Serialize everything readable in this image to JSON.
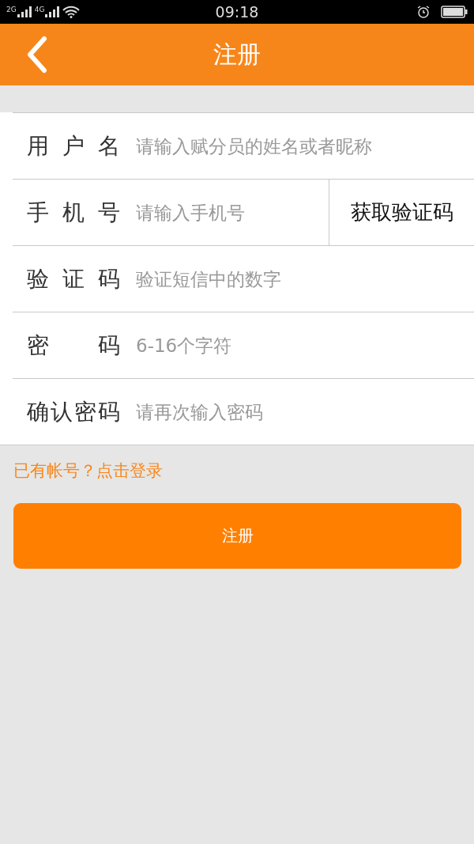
{
  "status_bar": {
    "signal_1": "2G",
    "signal_2": "4G",
    "time": "09:18"
  },
  "header": {
    "title": "注册"
  },
  "form": {
    "rows": [
      {
        "kind": "text",
        "label": "用 户 名",
        "placeholder": "请输入赋分员的姓名或者昵称"
      },
      {
        "kind": "code",
        "label": "手 机 号",
        "placeholder": "请输入手机号",
        "action": "获取验证码"
      },
      {
        "kind": "text",
        "label": "验 证 码",
        "placeholder": "验证短信中的数字"
      },
      {
        "kind": "text",
        "label": "密 码",
        "placeholder": "6-16个字符"
      },
      {
        "kind": "text",
        "label": "确认密码",
        "placeholder": "请再次输入密码"
      }
    ]
  },
  "login_link": "已有帐号？点击登录",
  "submit_button": "注册"
}
